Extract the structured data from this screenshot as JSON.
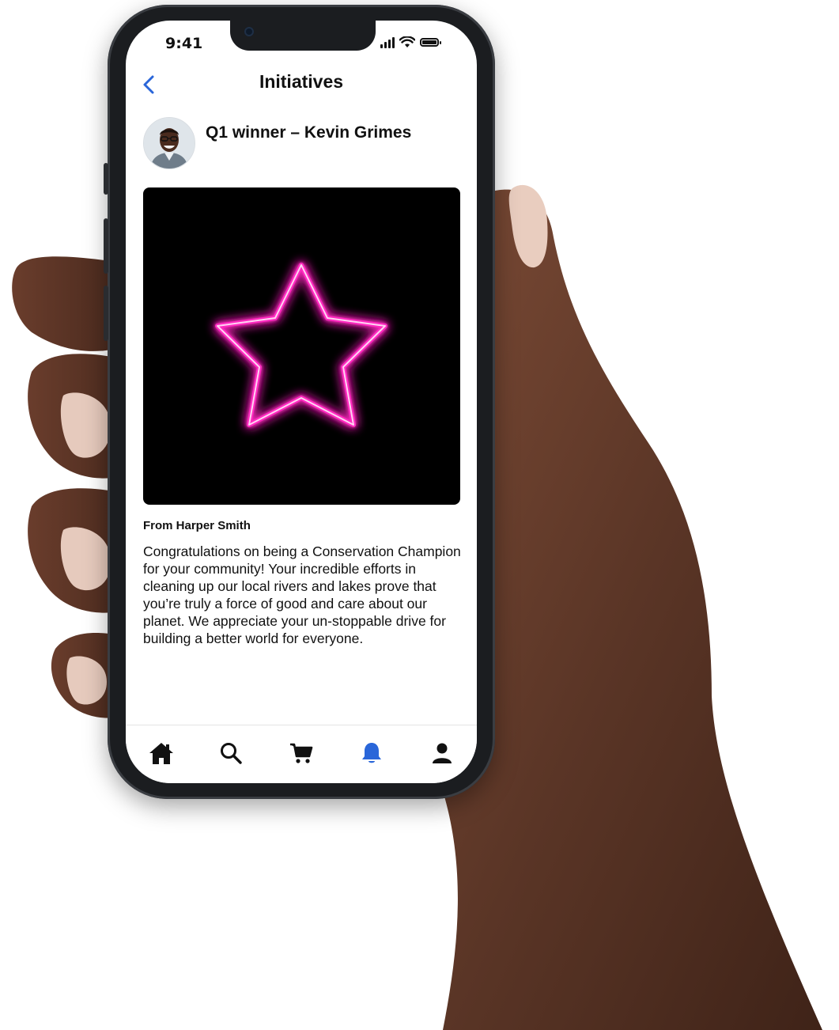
{
  "status_bar": {
    "time": "9:41"
  },
  "header": {
    "title": "Initiatives",
    "back_icon": "chevron-left-icon"
  },
  "post": {
    "title": "Q1 winner – Kevin Grimes",
    "avatar": "avatar",
    "image": "neon-star-image",
    "from": "From Harper Smith",
    "message": "Congratulations on being a Conservation Champion for your community! Your incredible efforts in cleaning up our local rivers and lakes prove that you’re truly a force of good and care about our planet. We appreciate your un-stoppable drive for building a better world for everyone."
  },
  "tab_bar": {
    "items": [
      {
        "icon": "home-icon",
        "active": false
      },
      {
        "icon": "search-icon",
        "active": false
      },
      {
        "icon": "cart-icon",
        "active": false
      },
      {
        "icon": "bell-icon",
        "active": true
      },
      {
        "icon": "profile-icon",
        "active": false
      }
    ]
  },
  "colors": {
    "accent": "#2a66d9",
    "neon": "#ff2bc0",
    "text": "#111111",
    "skin": "#5a3526"
  }
}
